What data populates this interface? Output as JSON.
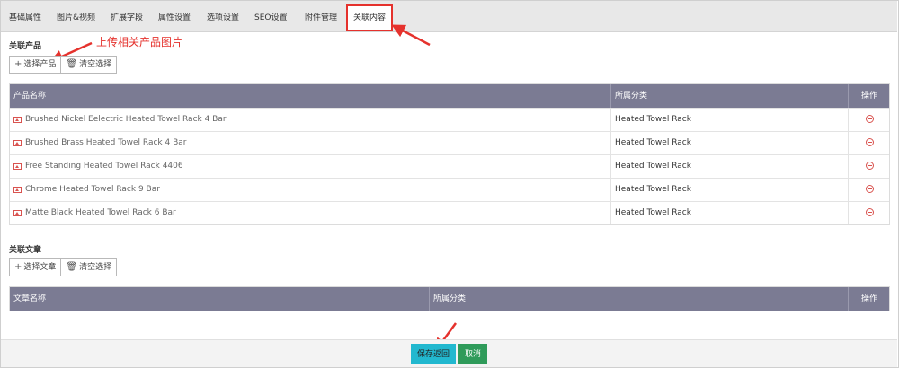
{
  "tabs": [
    "基础属性",
    "图片&视频",
    "扩展字段",
    "属性设置",
    "选项设置",
    "SEO设置",
    "附件管理",
    "关联内容"
  ],
  "annotation": "上传相关产品图片",
  "products_section": {
    "label": "关联产品",
    "select_button": "选择产品",
    "clear_button": "清空选择",
    "columns": {
      "name": "产品名称",
      "category": "所属分类",
      "action": "操作"
    },
    "rows": [
      {
        "name": "Brushed Nickel Eelectric Heated Towel Rack 4 Bar",
        "category": "Heated Towel Rack"
      },
      {
        "name": "Brushed Brass Heated Towel Rack 4 Bar",
        "category": "Heated Towel Rack"
      },
      {
        "name": "Free Standing Heated Towel Rack 4406",
        "category": "Heated Towel Rack"
      },
      {
        "name": "Chrome Heated Towel Rack 9 Bar",
        "category": "Heated Towel Rack"
      },
      {
        "name": "Matte Black Heated Towel Rack 6 Bar",
        "category": "Heated Towel Rack"
      }
    ]
  },
  "articles_section": {
    "label": "关联文章",
    "select_button": "选择文章",
    "clear_button": "清空选择",
    "columns": {
      "name": "文章名称",
      "category": "所属分类",
      "action": "操作"
    }
  },
  "footer": {
    "save_label": "保存返回",
    "cancel_label": "取消"
  },
  "colors": {
    "annotation": "#e5322d",
    "table_header": "#7b7b93",
    "save": "#22b8cf",
    "cancel": "#2f9b5a"
  }
}
